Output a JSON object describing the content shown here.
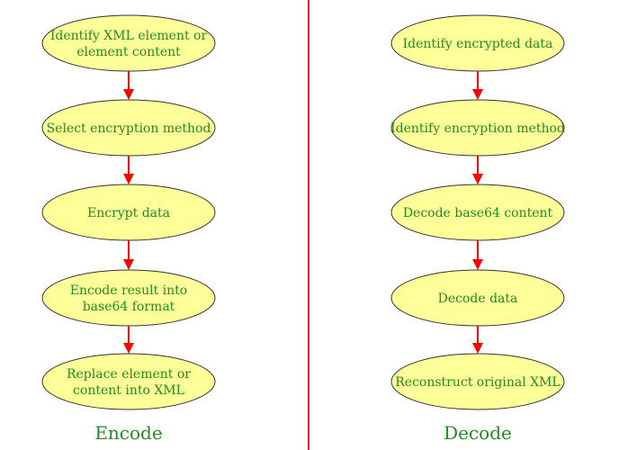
{
  "colors": {
    "node_fill": "#ffff99",
    "node_text": "#228b22",
    "arrow": "#ff0000",
    "divider": "#e8202a"
  },
  "columns": [
    {
      "id": "encode",
      "label": "Encode",
      "steps": [
        [
          "Identify XML element or",
          "element content"
        ],
        [
          "Select encryption method"
        ],
        [
          "Encrypt data"
        ],
        [
          "Encode result into",
          "base64 format"
        ],
        [
          "Replace element or",
          "content into XML"
        ]
      ]
    },
    {
      "id": "decode",
      "label": "Decode",
      "steps": [
        [
          "Identify encrypted data"
        ],
        [
          "Identify encryption method"
        ],
        [
          "Decode base64 content"
        ],
        [
          "Decode data"
        ],
        [
          "Reconstruct original XML"
        ]
      ]
    }
  ]
}
